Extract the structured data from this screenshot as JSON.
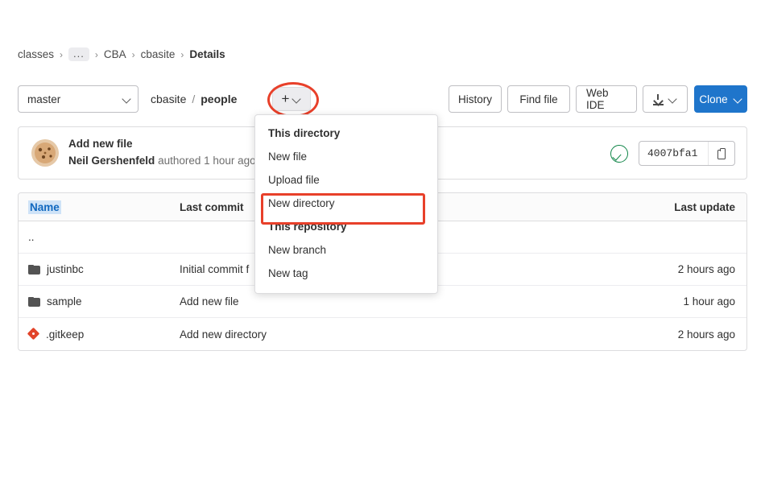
{
  "breadcrumb": {
    "items": [
      {
        "label": "classes",
        "type": "link"
      },
      {
        "label": "...",
        "type": "ellipsis"
      },
      {
        "label": "CBA",
        "type": "link"
      },
      {
        "label": "cbasite",
        "type": "link"
      },
      {
        "label": "Details",
        "type": "current"
      }
    ]
  },
  "toolbar": {
    "branch": "master",
    "branch_icon": "chevron-down-icon",
    "path": {
      "repo": "cbasite",
      "separator": "/",
      "folder": "people"
    },
    "add_button": {
      "plus": "+",
      "icon": "chevron-down-icon"
    },
    "history_label": "History",
    "find_file_label": "Find file",
    "web_ide_label": "Web IDE",
    "download_icon": "download-icon",
    "clone_label": "Clone"
  },
  "commit": {
    "avatar": "user-avatar",
    "title": "Add new file",
    "author": "Neil Gershenfeld",
    "action": "authored",
    "time": "1 hour ago",
    "status_icon": "pipeline-success-icon",
    "sha": "4007bfa1",
    "copy_icon": "copy-icon"
  },
  "table": {
    "columns": {
      "name": "Name",
      "last_commit": "Last commit",
      "last_update": "Last update"
    },
    "rows": [
      {
        "icon": "",
        "name": "..",
        "last_commit": "",
        "last_update": ""
      },
      {
        "icon": "folder-icon",
        "name": "justinbc",
        "last_commit": "Initial commit f",
        "last_update": "2 hours ago"
      },
      {
        "icon": "folder-icon",
        "name": "sample",
        "last_commit": "Add new file",
        "last_update": "1 hour ago"
      },
      {
        "icon": "gitkeep-icon",
        "name": ".gitkeep",
        "last_commit": "Add new directory",
        "last_update": "2 hours ago"
      }
    ]
  },
  "menu": {
    "sections": [
      {
        "group": "This directory",
        "items": [
          {
            "label": "New file",
            "highlighted": false
          },
          {
            "label": "Upload file",
            "highlighted": false
          },
          {
            "label": "New directory",
            "highlighted": true
          }
        ]
      },
      {
        "group": "This repository",
        "items": [
          {
            "label": "New branch",
            "highlighted": false
          },
          {
            "label": "New tag",
            "highlighted": false
          }
        ]
      }
    ]
  },
  "annotations": {
    "highlight_color": "#e8402a",
    "accent_color": "#1f75cb",
    "success_color": "#108548"
  }
}
